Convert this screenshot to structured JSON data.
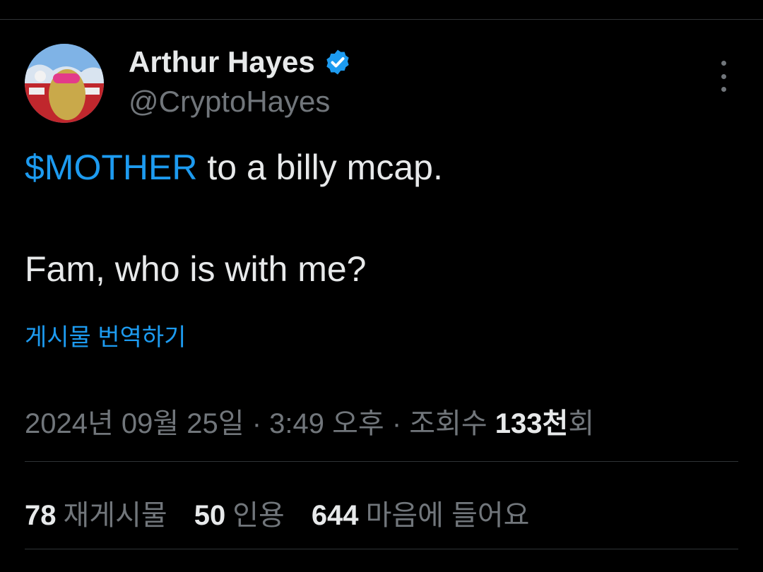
{
  "author": {
    "name": "Arthur Hayes",
    "handle": "@CryptoHayes",
    "verified": true,
    "avatar_icon": "profile-avatar-goggles-character"
  },
  "tweet": {
    "cashtag": "$MOTHER",
    "line1_rest": " to a billy mcap.",
    "line2": "Fam, who is with me?"
  },
  "translate_label": "게시물 번역하기",
  "meta": {
    "date": "2024년 09월 25일",
    "sep1": " · ",
    "time": "3:49 오후",
    "sep2": " · ",
    "views_prefix": "조회수 ",
    "views_num": "133천",
    "views_suffix": "회"
  },
  "stats": [
    {
      "num": "78",
      "label": "재게시물"
    },
    {
      "num": "50",
      "label": "인용"
    },
    {
      "num": "644",
      "label": "마음에 들어요"
    }
  ],
  "colors": {
    "background": "#000000",
    "accent": "#1d9bf0",
    "text_primary": "#e7e9ea",
    "text_secondary": "#71767b"
  }
}
